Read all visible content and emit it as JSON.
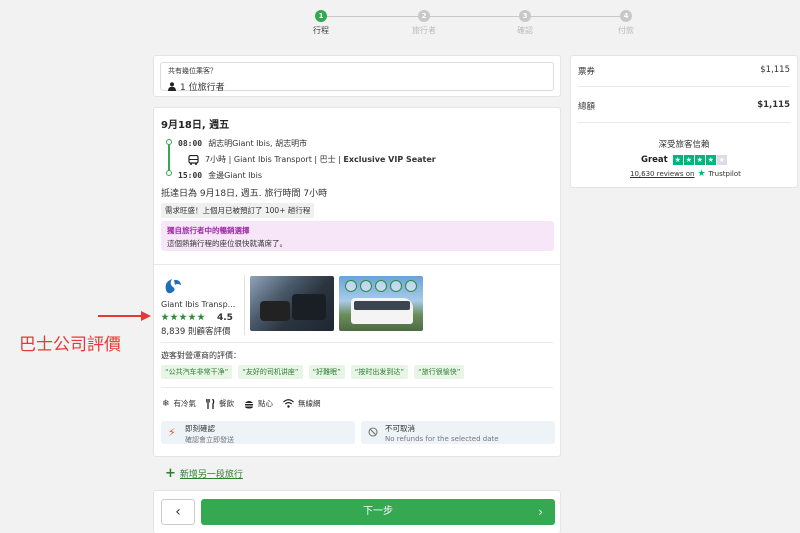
{
  "stepper": {
    "steps": [
      {
        "num": "1",
        "label": "行程",
        "active": true
      },
      {
        "num": "2",
        "label": "旅行者",
        "active": false
      },
      {
        "num": "3",
        "label": "確認",
        "active": false
      },
      {
        "num": "4",
        "label": "付款",
        "active": false
      }
    ]
  },
  "passengers": {
    "question": "共有幾位乘客？",
    "value": "1 位旅行者",
    "icon": "person-icon"
  },
  "trip": {
    "date": "9月18日, 週五",
    "departure_time": "08:00",
    "departure_place": "胡志明Giant Ibis, 胡志明市",
    "bus_info": "7小時 | Giant Ibis Transport | 巴士 | ",
    "bus_class": "Exclusive VIP Seater",
    "arrival_time": "15:00",
    "arrival_place": "金邊Giant Ibis",
    "arrival_summary": "抵達日為 9月18日, 週五. 旅行時間 7小時",
    "demand": "需求旺盛！上個月已被預訂了 100+ 趟行程",
    "promo_title": "獨自旅行者中的暢銷選擇",
    "promo_text": "這個熱銷行程的座位很快就滿席了。"
  },
  "operator": {
    "name": "Giant Ibis Transp...",
    "rating": "4.5",
    "review_count": "8,839 則顧客評價",
    "review_heading": "遊客對營運商的評價：",
    "tags": [
      "“公共汽车非常干净”",
      "“友好的司机讲座”",
      "“好難眠”",
      "“按时出发到达”",
      "“旅行很愉快”"
    ]
  },
  "amenities": [
    {
      "icon": "snowflake-icon",
      "glyph": "❄",
      "label": "有冷氣"
    },
    {
      "icon": "utensils-icon",
      "glyph": "🍴",
      "label": "餐飲"
    },
    {
      "icon": "snack-icon",
      "glyph": "☰",
      "label": "點心"
    },
    {
      "icon": "wifi-icon",
      "glyph": "≋",
      "label": "無線網"
    }
  ],
  "policies": {
    "instant_title": "即刻確認",
    "instant_sub": "確認會立即發送",
    "cancel_title": "不可取消",
    "cancel_sub": "No refunds for the selected date"
  },
  "add_trip": "新增另一段旅行",
  "nav": {
    "back_glyph": "‹",
    "next_label": "下一步",
    "next_glyph": "›"
  },
  "summary": {
    "ticket_label": "票券",
    "ticket_value": "$1,115",
    "total_label": "總額",
    "total_value": "$1,115",
    "trust_title": "深受旅客信賴",
    "trust_rating": "Great",
    "trust_reviews": "10,630 reviews on",
    "trust_brand": "Trustpilot",
    "trust_stars_filled": 4,
    "trust_stars_total": 5
  },
  "annotation": {
    "label": "巴士公司評價",
    "color": "#e53935"
  },
  "colors": {
    "accent": "#35a852",
    "promo_text": "#a02aa8",
    "trustpilot": "#00b67a"
  }
}
